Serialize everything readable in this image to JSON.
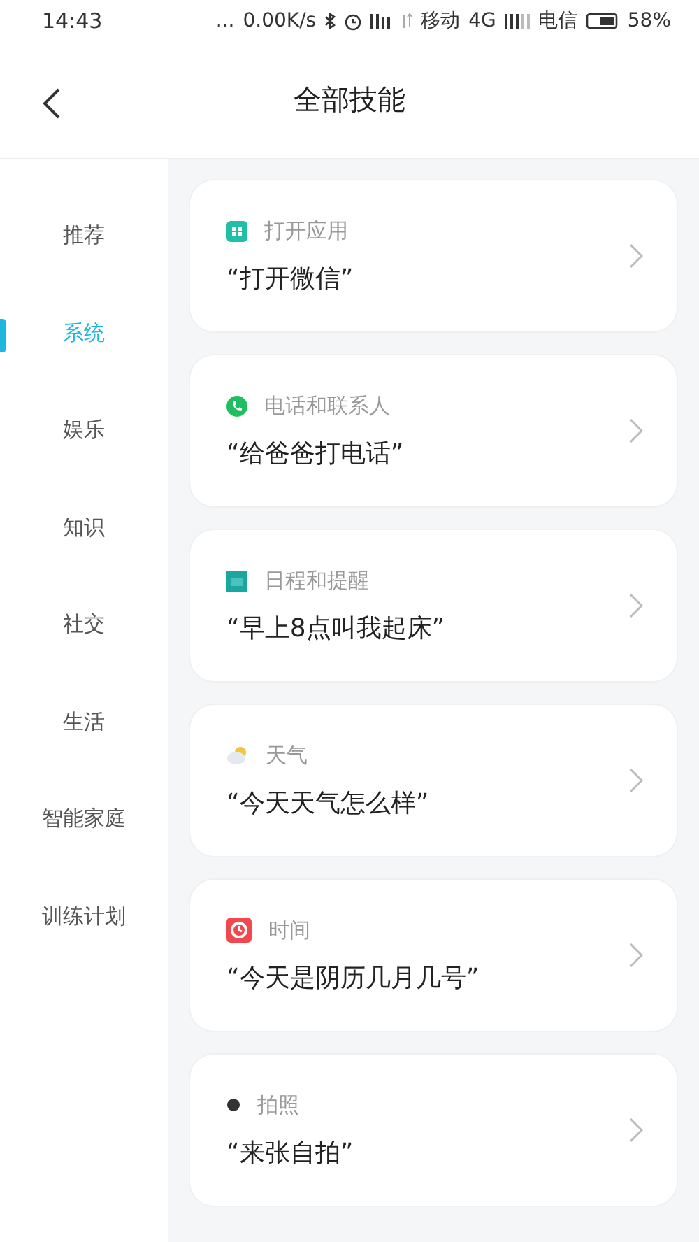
{
  "status_bar": {
    "time": "14:43",
    "dots": "...",
    "speed": "0.00K/s",
    "carrier_1": "移动",
    "network": "4G",
    "carrier_2": "电信",
    "battery": "58%"
  },
  "header": {
    "title": "全部技能"
  },
  "sidebar": {
    "items": [
      {
        "label": "推荐",
        "selected": false
      },
      {
        "label": "系统",
        "selected": true
      },
      {
        "label": "娱乐",
        "selected": false
      },
      {
        "label": "知识",
        "selected": false
      },
      {
        "label": "社交",
        "selected": false
      },
      {
        "label": "生活",
        "selected": false
      },
      {
        "label": "智能家庭",
        "selected": false
      },
      {
        "label": "训练计划",
        "selected": false
      }
    ]
  },
  "skills": [
    {
      "kind": "apps",
      "category": "打开应用",
      "example": "“打开微信”"
    },
    {
      "kind": "phone",
      "category": "电话和联系人",
      "example": "“给爸爸打电话”"
    },
    {
      "kind": "calendar",
      "category": "日程和提醒",
      "example": "“早上8点叫我起床”"
    },
    {
      "kind": "weather",
      "category": "天气",
      "example": "“今天天气怎么样”"
    },
    {
      "kind": "clock",
      "category": "时间",
      "example": "“今天是阴历几月几号”"
    },
    {
      "kind": "camera",
      "category": "拍照",
      "example": "“来张自拍”"
    }
  ]
}
